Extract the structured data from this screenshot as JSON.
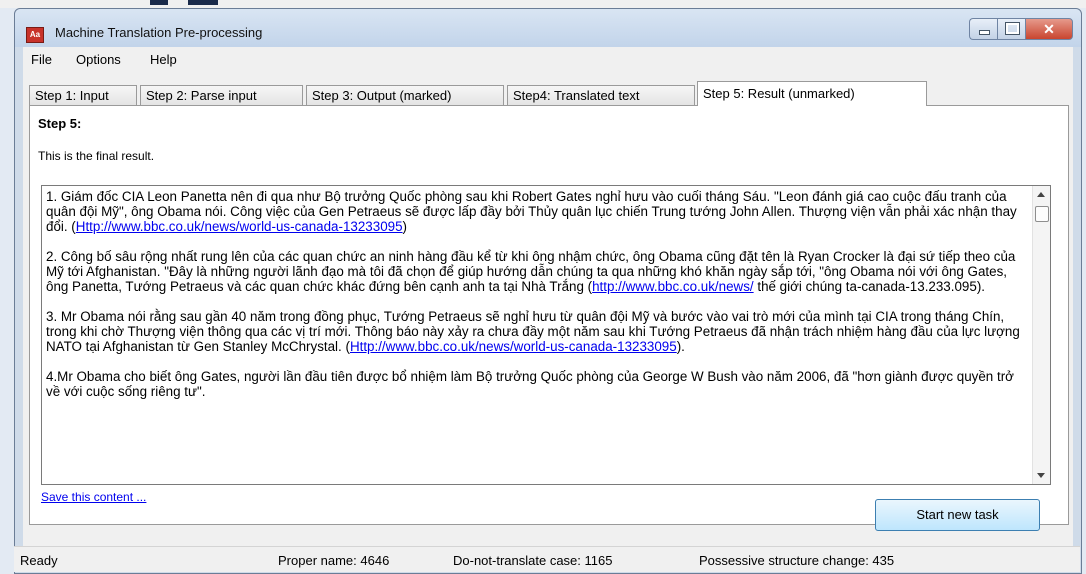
{
  "window": {
    "title": "Machine Translation Pre-processing",
    "icon_text": "Aa",
    "close_glyph": "✕"
  },
  "menu": [
    "File",
    "Options",
    "Help"
  ],
  "tabs": [
    "Step 1: Input",
    "Step 2: Parse input",
    "Step 3: Output (marked)",
    "Step4: Translated text",
    "Step 5: Result (unmarked)"
  ],
  "active_tab": "Step 5: Result (unmarked)",
  "panel": {
    "heading": "Step 5:",
    "description": "This is the final result."
  },
  "result": {
    "paragraphs": [
      {
        "text": "1. Giám đốc CIA Leon Panetta nên đi qua như Bộ trưởng Quốc phòng sau khi Robert Gates nghỉ hưu vào cuối tháng Sáu. \"Leon đánh giá cao cuộc đấu tranh của quân đội Mỹ\", ông Obama nói. Công việc của Gen Petraeus sẽ được lấp đầy bởi Thủy quân lục chiến Trung tướng John Allen. Thượng viện vẫn phải xác nhận thay đổi. (",
        "link": "Http://www.bbc.co.uk/news/world-us-canada-13233095",
        "after": ")"
      },
      {
        "text": "2. Công bố sâu rộng nhất rung lên của các quan chức an ninh hàng đầu kể từ khi ông nhậm chức, ông Obama cũng đặt tên là Ryan Crocker là đại sứ tiếp theo của Mỹ tới Afghanistan. \"Đây là những người lãnh đạo mà tôi đã chọn để giúp hướng dẫn chúng ta qua những khó khăn ngày sắp tới, \"ông Obama nói với ông Gates, ông Panetta, Tướng Petraeus và các quan chức khác đứng bên cạnh anh ta tại Nhà Trắng (",
        "link": "http://www.bbc.co.uk/news/",
        "after": " thế giới chúng ta-canada-13.233.095)."
      },
      {
        "text": "3. Mr Obama nói rằng sau gần 40 năm trong đồng phục, Tướng Petraeus sẽ nghỉ hưu từ quân đội Mỹ và bước vào vai trò mới của mình tại CIA trong tháng Chín, trong khi chờ Thượng viện thông qua các vị trí mới. Thông báo này xảy ra chưa đầy một năm sau khi Tướng Petraeus đã nhận trách nhiệm hàng đầu của lực lượng NATO tại Afghanistan từ Gen Stanley McChrystal. (",
        "link": "Http://www.bbc.co.uk/news/world-us-canada-13233095",
        "after": ")."
      },
      {
        "text": "4.Mr Obama cho biết ông Gates, người lần đầu tiên được bổ nhiệm làm Bộ trưởng Quốc phòng của George W Bush vào năm 2006, đã \"hơn giành được quyền trở về với cuộc sống riêng tư\".",
        "link": "",
        "after": ""
      }
    ]
  },
  "actions": {
    "save_label": "Save this content ...",
    "start_label": "Start new task"
  },
  "statusbar": {
    "ready": "Ready",
    "proper_name": "Proper name: 4646",
    "do_not_translate": "Do-not-translate case: 1165",
    "possessive": "Possessive structure change: 435"
  }
}
